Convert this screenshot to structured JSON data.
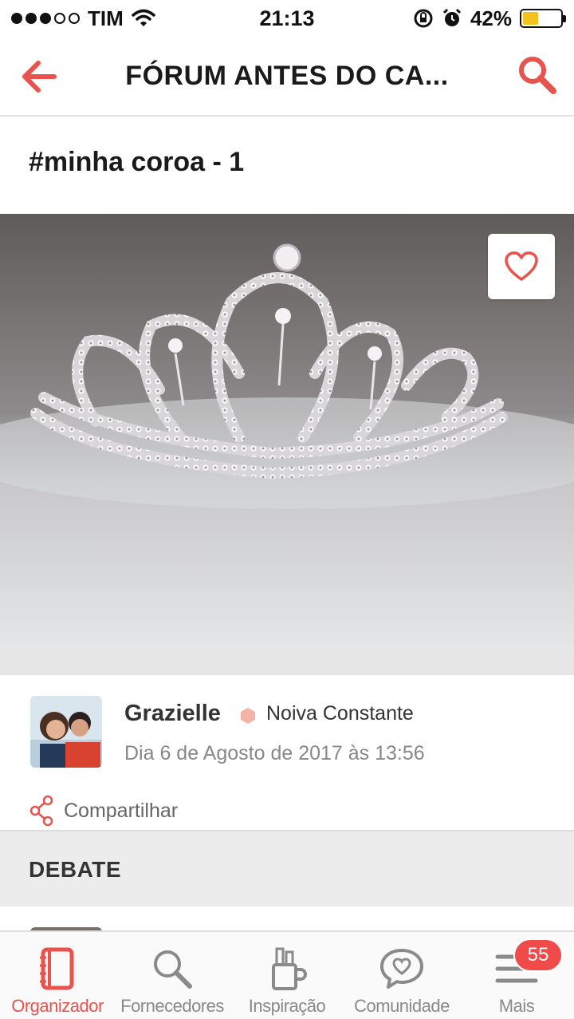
{
  "status_bar": {
    "carrier": "TIM",
    "time": "21:13",
    "battery_percent": "42%",
    "battery_level": 0.42,
    "signal_bars_filled": 3,
    "signal_bars_total": 5
  },
  "header": {
    "title": "FÓRUM ANTES DO CA...",
    "back_icon": "arrow-left-icon",
    "search_icon": "search-icon",
    "accent_color": "#e8534d"
  },
  "post": {
    "title": "#minha coroa - 1",
    "image_description_icon": "heart-icon"
  },
  "author": {
    "name": "Grazielle",
    "badge": "Noiva Constante",
    "badge_color": "#f4b3a6",
    "date": "Dia 6 de Agosto de 2017 às 13:56"
  },
  "share": {
    "label": "Compartilhar",
    "icon": "share-icon"
  },
  "debate": {
    "label": "DEBATE"
  },
  "tabbar": {
    "tabs": [
      {
        "label": "Organizador",
        "icon": "notebook-icon",
        "active": true
      },
      {
        "label": "Fornecedores",
        "icon": "search-icon",
        "active": false
      },
      {
        "label": "Inspiração",
        "icon": "inspiration-icon",
        "active": false
      },
      {
        "label": "Comunidade",
        "icon": "chat-heart-icon",
        "active": false
      },
      {
        "label": "Mais",
        "icon": "menu-icon",
        "active": false,
        "badge": "55"
      }
    ]
  }
}
